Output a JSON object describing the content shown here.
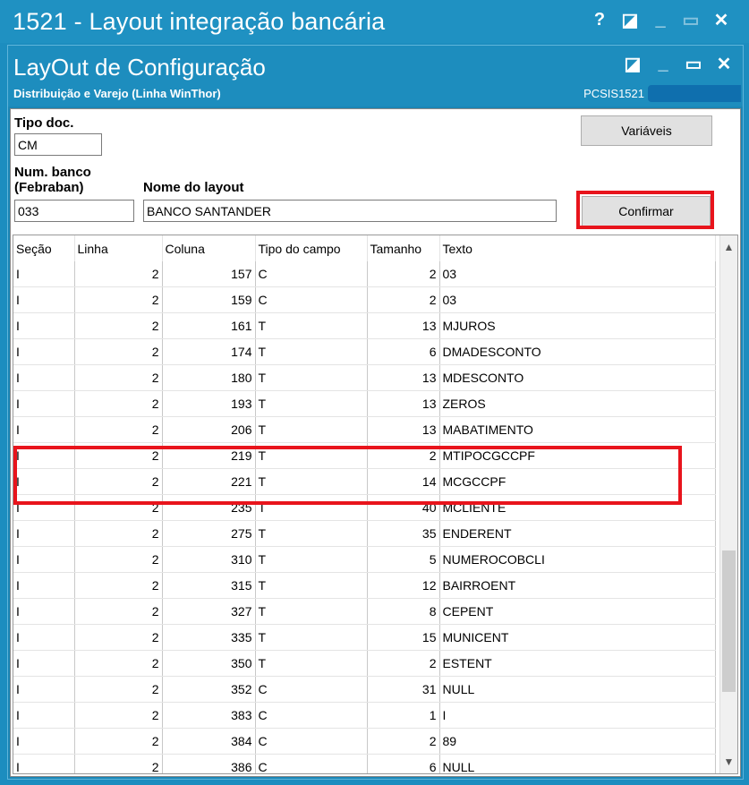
{
  "window": {
    "title": "1521 - Layout integração bancária",
    "buttons": [
      "?",
      "◪",
      "_",
      "▭",
      "✕"
    ]
  },
  "dialog": {
    "title": "LayOut de Configuração",
    "subtitle": "Distribuição e Varejo (Linha WinThor)",
    "code": "PCSIS1521",
    "buttons": [
      "◪",
      "_",
      "▭",
      "✕"
    ]
  },
  "form": {
    "tipo_doc_label": "Tipo doc.",
    "tipo_doc_value": "CM",
    "num_banco_label_1": "Num. banco",
    "num_banco_label_2": "(Febraban)",
    "num_banco_value": "033",
    "nome_layout_label": "Nome do layout",
    "nome_layout_value": "BANCO SANTANDER",
    "variaveis_label": "Variáveis",
    "confirmar_label": "Confirmar"
  },
  "grid": {
    "columns": [
      "Seção",
      "Linha",
      "Coluna",
      "Tipo do campo",
      "Tamanho",
      "Texto"
    ],
    "rows": [
      [
        "I",
        "2",
        "157",
        "C",
        "2",
        "03"
      ],
      [
        "I",
        "2",
        "159",
        "C",
        "2",
        "03"
      ],
      [
        "I",
        "2",
        "161",
        "T",
        "13",
        "MJUROS"
      ],
      [
        "I",
        "2",
        "174",
        "T",
        "6",
        "DMADESCONTO"
      ],
      [
        "I",
        "2",
        "180",
        "T",
        "13",
        "MDESCONTO"
      ],
      [
        "I",
        "2",
        "193",
        "T",
        "13",
        "ZEROS"
      ],
      [
        "I",
        "2",
        "206",
        "T",
        "13",
        "MABATIMENTO"
      ],
      [
        "I",
        "2",
        "219",
        "T",
        "2",
        "MTIPOCGCCPF"
      ],
      [
        "I",
        "2",
        "221",
        "T",
        "14",
        "MCGCCPF"
      ],
      [
        "I",
        "2",
        "235",
        "T",
        "40",
        "MCLIENTE"
      ],
      [
        "I",
        "2",
        "275",
        "T",
        "35",
        "ENDERENT"
      ],
      [
        "I",
        "2",
        "310",
        "T",
        "5",
        "NUMEROCOBCLI"
      ],
      [
        "I",
        "2",
        "315",
        "T",
        "12",
        "BAIRROENT"
      ],
      [
        "I",
        "2",
        "327",
        "T",
        "8",
        "CEPENT"
      ],
      [
        "I",
        "2",
        "335",
        "T",
        "15",
        "MUNICENT"
      ],
      [
        "I",
        "2",
        "350",
        "T",
        "2",
        "ESTENT"
      ],
      [
        "I",
        "2",
        "352",
        "C",
        "31",
        "NULL"
      ],
      [
        "I",
        "2",
        "383",
        "C",
        "1",
        "I"
      ],
      [
        "I",
        "2",
        "384",
        "C",
        "2",
        "89"
      ],
      [
        "I",
        "2",
        "386",
        "C",
        "6",
        "NULL"
      ]
    ]
  },
  "colors": {
    "titlebar": "#1f91c2",
    "highlight": "#e8141c"
  }
}
